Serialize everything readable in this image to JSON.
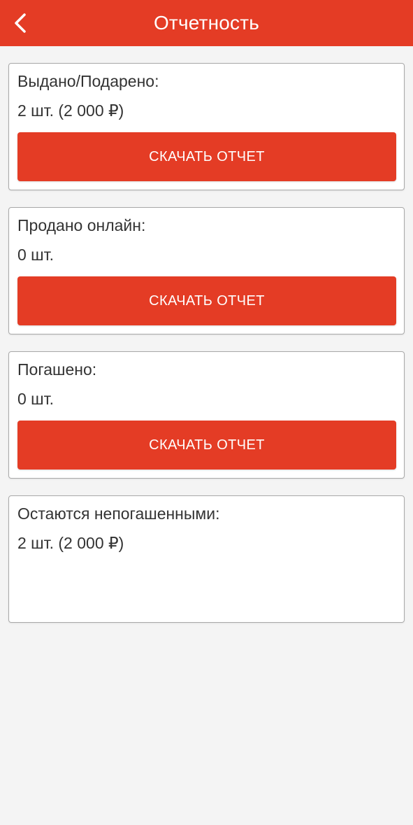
{
  "header": {
    "title": "Отчетность",
    "back_icon": "chevron-left-icon"
  },
  "colors": {
    "accent": "#e43c25",
    "background": "#f4f4f4",
    "card": "#ffffff",
    "text": "#333333"
  },
  "cards": [
    {
      "label": "Выдано/Подарено:",
      "value": "2 шт. (2 000 ₽)",
      "button": "СКАЧАТЬ ОТЧЕТ"
    },
    {
      "label": "Продано онлайн:",
      "value": "0 шт.",
      "button": "СКАЧАТЬ ОТЧЕТ"
    },
    {
      "label": "Погашено:",
      "value": "0 шт.",
      "button": "СКАЧАТЬ ОТЧЕТ"
    },
    {
      "label": "Остаются непогашенными:",
      "value": "2 шт. (2 000 ₽)"
    }
  ]
}
